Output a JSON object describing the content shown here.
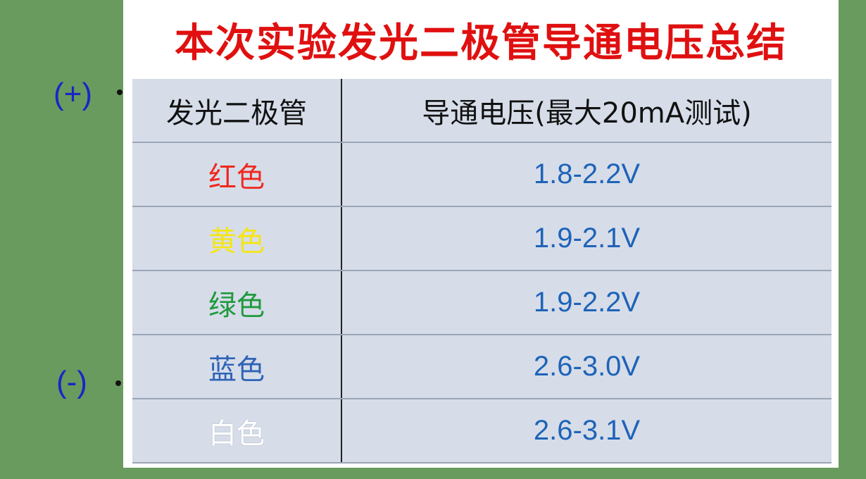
{
  "left_labels": {
    "positive": "(+)",
    "negative": "(-)"
  },
  "title": "本次实验发光二极管导通电压总结",
  "table": {
    "headers": [
      "发光二极管",
      "导通电压(最大20mA测试)"
    ],
    "rows": [
      {
        "color_name": "红色",
        "voltage": "1.8-2.2V",
        "text_color": "#f0281e"
      },
      {
        "color_name": "黄色",
        "voltage": "1.9-2.1V",
        "text_color": "#f5e514"
      },
      {
        "color_name": "绿色",
        "voltage": "1.9-2.2V",
        "text_color": "#1f9a3c"
      },
      {
        "color_name": "蓝色",
        "voltage": "2.6-3.0V",
        "text_color": "#2f63b5"
      },
      {
        "color_name": "白色",
        "voltage": "2.6-3.1V",
        "text_color": "#ffffff"
      }
    ]
  },
  "colors": {
    "background": "#6a9b5e",
    "title": "#e01010",
    "voltage": "#1e63b8",
    "sign_labels": "#1a25c8"
  }
}
